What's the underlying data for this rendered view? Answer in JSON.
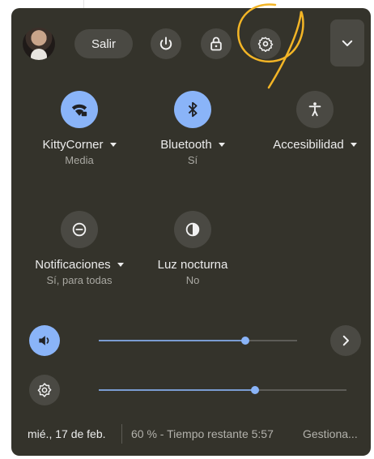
{
  "header": {
    "signout_label": "Salir",
    "icons": [
      "power-icon",
      "lock-icon",
      "settings-icon",
      "chevron-down-icon"
    ]
  },
  "tiles": [
    {
      "label": "KittyCorner",
      "sub": "Media",
      "icon": "wifi-lock-icon",
      "active": true,
      "has_menu": true
    },
    {
      "label": "Bluetooth",
      "sub": "Sí",
      "icon": "bluetooth-icon",
      "active": true,
      "has_menu": true
    },
    {
      "label": "Accesibilidad",
      "sub": "",
      "icon": "accessibility-icon",
      "active": false,
      "has_menu": true
    },
    {
      "label": "Notificaciones",
      "sub": "Sí, para todas",
      "icon": "do-not-disturb-icon",
      "active": false,
      "has_menu": true
    },
    {
      "label": "Luz nocturna",
      "sub": "No",
      "icon": "night-light-icon",
      "active": false,
      "has_menu": false
    }
  ],
  "sliders": {
    "volume": {
      "icon": "volume-icon",
      "level": 0.74
    },
    "brightness": {
      "icon": "brightness-icon",
      "level": 0.63
    }
  },
  "footer": {
    "date": "mié., 17 de feb.",
    "battery": "60 % - Tiempo restante 5:57",
    "manage": "Gestiona..."
  },
  "colors": {
    "panel": "#34332b",
    "accent": "#8ab4f8",
    "button": "#4a4943",
    "annotation": "#f3b526"
  }
}
